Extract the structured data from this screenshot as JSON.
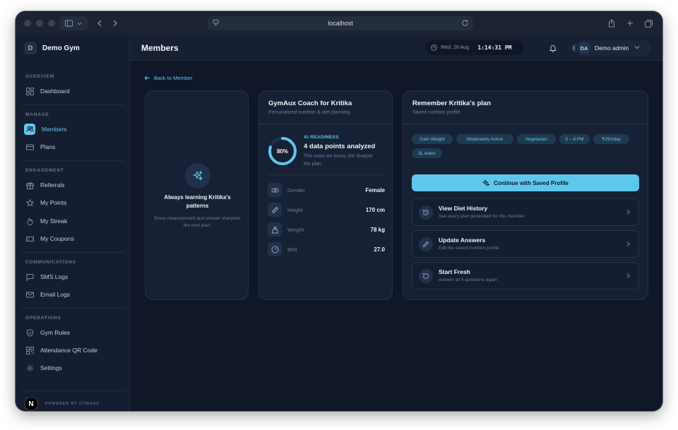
{
  "browser": {
    "url": "localhost"
  },
  "sidebar": {
    "brand_badge": "D",
    "brand_name": "Demo Gym",
    "sections": {
      "overview": "OVERVIEW",
      "manage": "MANAGE",
      "engagement": "ENGAGEMENT",
      "communications": "COMMUNICATIONS",
      "operations": "OPERATIONS"
    },
    "items": {
      "dashboard": "Dashboard",
      "members": "Members",
      "plans": "Plans",
      "referrals": "Referrals",
      "my_points": "My Points",
      "my_streak": "My Streak",
      "my_coupons": "My Coupons",
      "sms_logs": "SMS Logs",
      "email_logs": "Email Logs",
      "gym_rules": "Gym Rules",
      "attendance_qr": "Attendance QR Code",
      "settings": "Settings"
    },
    "powered_badge": "N",
    "powered_text": "POWERED BY GYMAUX"
  },
  "header": {
    "title": "Members",
    "date": "Wed, 26 Aug",
    "separator": "·",
    "time": "1:14:31 PM",
    "user_initials": "DA",
    "user_name": "Demo admin"
  },
  "main": {
    "back_link": "Back to Member",
    "learning": {
      "title": "Always learning Kritika's patterns",
      "subtitle": "Every measurement and answer sharpens the next plan."
    },
    "coach": {
      "title": "GymAux Coach for Kritika",
      "subtitle": "Personalized nutrition & diet planning",
      "readiness_percent": 80,
      "readiness_label": "80%",
      "ai_tag": "AI READINESS",
      "data_points": "4 data points analyzed",
      "description": "The more we know, the sharper the plan.",
      "metrics": [
        {
          "label": "Gender",
          "value": "Female"
        },
        {
          "label": "Height",
          "value": "170 cm"
        },
        {
          "label": "Weight",
          "value": "78 kg"
        },
        {
          "label": "BMI",
          "value": "27.0"
        }
      ]
    },
    "plan": {
      "title": "Remember Kritika's plan",
      "subtitle": "Saved nutrition profile",
      "chips": [
        "Gain Weight",
        "Moderately Active",
        "Vegetarian",
        "5 – 8 PM",
        "₹250/day",
        "3L water"
      ],
      "continue_label": "Continue with Saved Profile",
      "actions": [
        {
          "title": "View Diet History",
          "subtitle": "See every plan generated for this member"
        },
        {
          "title": "Update Answers",
          "subtitle": "Edit the saved nutrition profile"
        },
        {
          "title": "Start Fresh",
          "subtitle": "Answer all 9 questions again"
        }
      ]
    }
  },
  "colors": {
    "accent": "#5ec8ec",
    "background": "#0f1728",
    "card": "#172135"
  }
}
